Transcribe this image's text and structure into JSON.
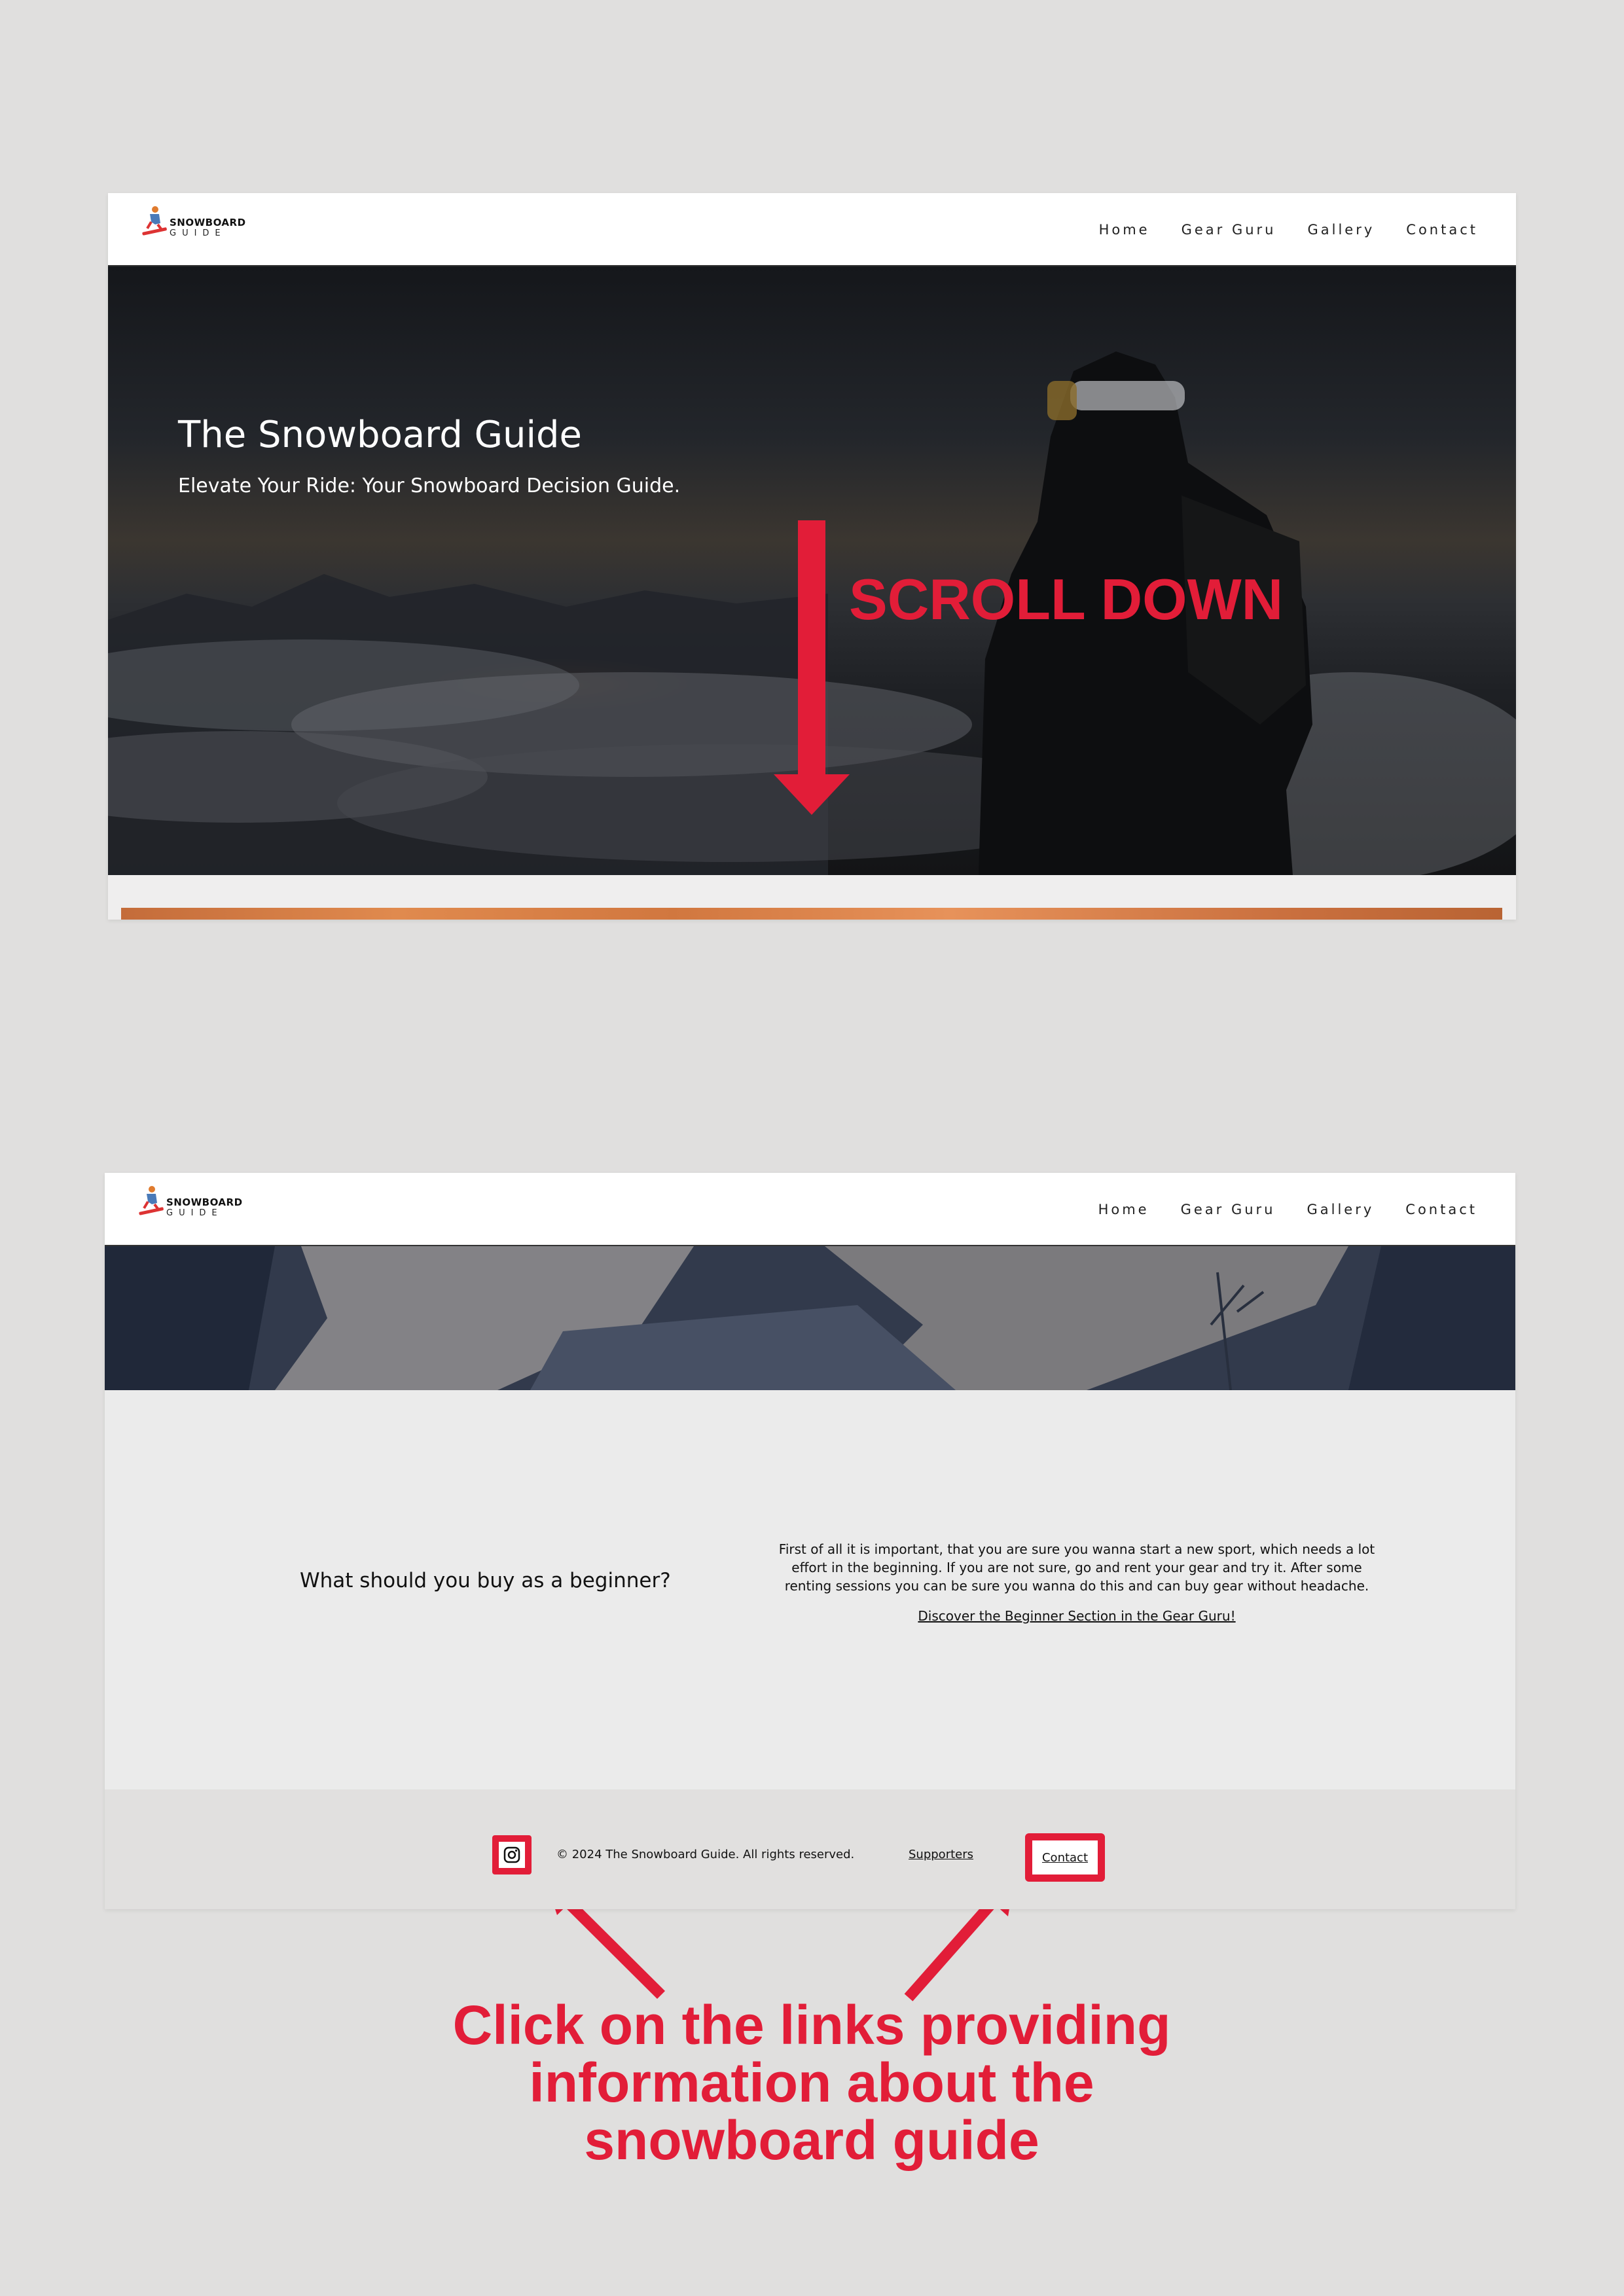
{
  "site": {
    "logo_word_top": "SNOWBOARD",
    "logo_word_bottom": "GUIDE",
    "nav": [
      "Home",
      "Gear Guru",
      "Gallery",
      "Contact"
    ]
  },
  "hero": {
    "title": "The Snowboard Guide",
    "subtitle": "Elevate Your Ride: Your Snowboard Decision Guide."
  },
  "annotations": {
    "scroll_label": "SCROLL DOWN",
    "instruction": "Click on the links providing information about the snowboard guide",
    "accent_color": "#e21d38"
  },
  "beginner_section": {
    "question": "What should you buy as a beginner?",
    "answer": "First of all it is important, that you are sure you wanna start a new sport, which needs a lot effort in the beginning. If you are not sure, go and rent your gear and try it. After some renting sessions you can be sure you wanna do this and can buy gear without headache.",
    "link": "Discover the Beginner Section in the Gear Guru!"
  },
  "footer": {
    "instagram_icon": "instagram-icon",
    "copyright": "© 2024 The Snowboard Guide. All rights reserved.",
    "supporters": "Supporters",
    "contact": "Contact"
  }
}
